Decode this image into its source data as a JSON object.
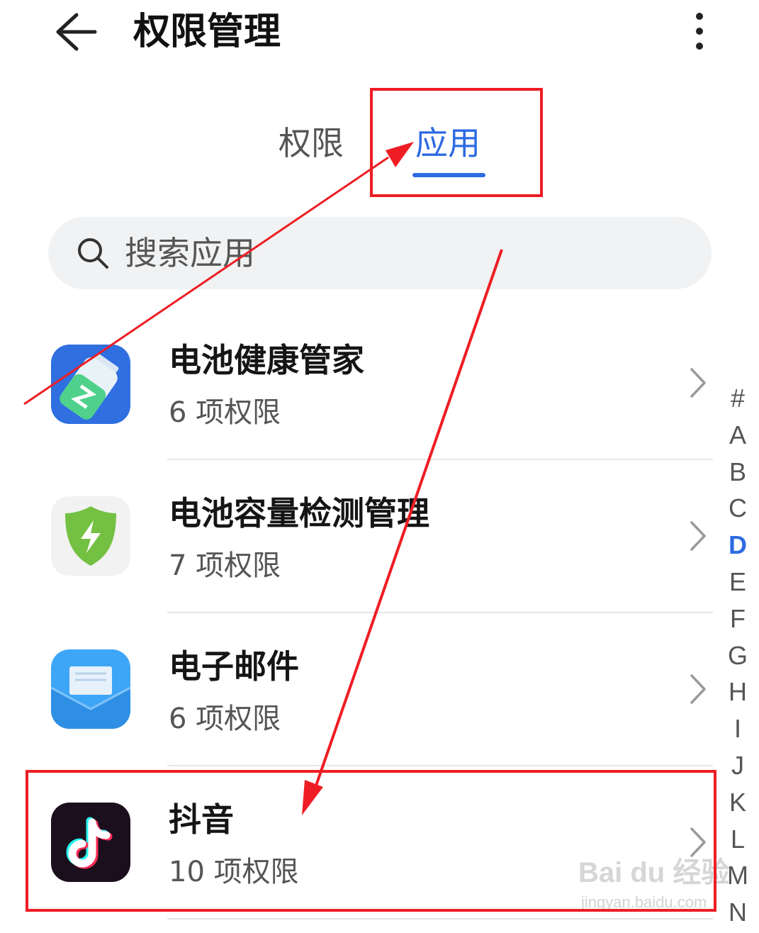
{
  "header": {
    "title": "权限管理",
    "back_icon": "arrow-left-icon",
    "more_icon": "more-vertical-icon"
  },
  "tabs": [
    {
      "label": "权限",
      "selected": false
    },
    {
      "label": "应用",
      "selected": true
    }
  ],
  "search": {
    "placeholder": "搜索应用",
    "icon": "search-icon"
  },
  "apps": [
    {
      "name": "电池健康管家",
      "permissions": "6 项权限",
      "icon": "battery-health-icon"
    },
    {
      "name": "电池容量检测管理",
      "permissions": "7 项权限",
      "icon": "shield-bolt-icon"
    },
    {
      "name": "电子邮件",
      "permissions": "6 项权限",
      "icon": "email-icon"
    },
    {
      "name": "抖音",
      "permissions": "10 项权限",
      "icon": "tiktok-icon"
    }
  ],
  "index_bar": {
    "letters": [
      "#",
      "A",
      "B",
      "C",
      "D",
      "E",
      "F",
      "G",
      "H",
      "I",
      "J",
      "K",
      "L",
      "M",
      "N"
    ],
    "active": "D"
  },
  "watermark": {
    "brand": "Bai du 经验",
    "url": "jingyan.baidu.com"
  },
  "colors": {
    "accent": "#2d6ae3",
    "annotation": "#ee1d24"
  }
}
